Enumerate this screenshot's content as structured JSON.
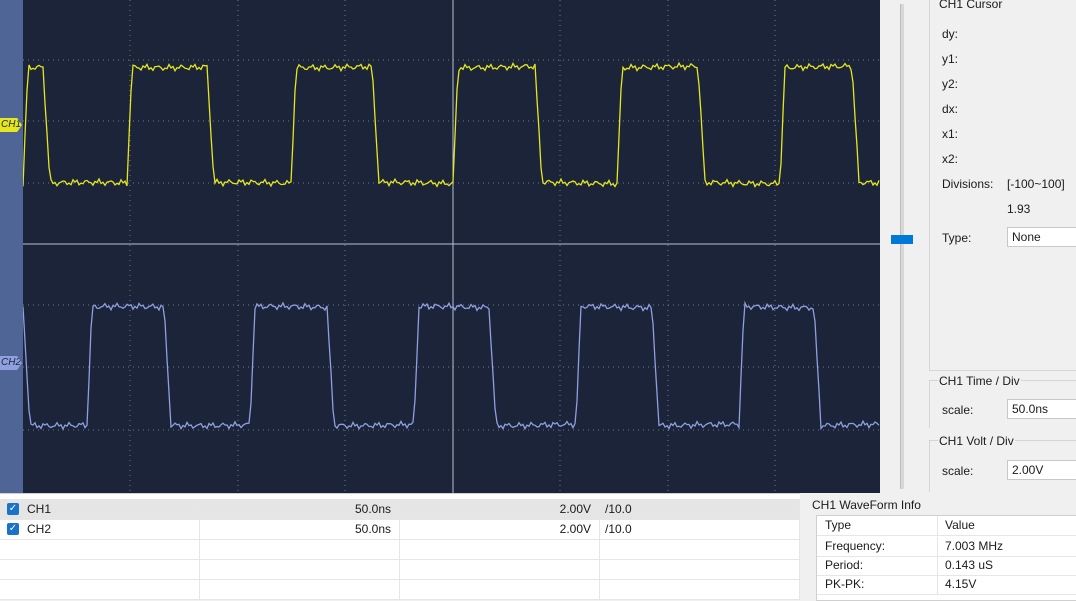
{
  "scope": {
    "ch1_marker": "CH1",
    "ch2_marker": "CH2",
    "ch1_color": "#e6e61e",
    "ch2_color": "#8f9fe0",
    "background": "#1b2438"
  },
  "cursor_panel": {
    "title": "CH1 Cursor",
    "dy_label": "dy:",
    "y1_label": "y1:",
    "y2_label": "y2:",
    "dx_label": "dx:",
    "x1_label": "x1:",
    "x2_label": "x2:",
    "divisions_label": "Divisions:",
    "divisions_range": "[-100~100]",
    "divisions_value": "1.93",
    "type_label": "Type:",
    "type_value": "None"
  },
  "time_panel": {
    "title": "CH1 Time / Div",
    "scale_label": "scale:",
    "scale_value": "50.0ns"
  },
  "volt_panel": {
    "title": "CH1 Volt / Div",
    "scale_label": "scale:",
    "scale_value": "2.00V"
  },
  "channels": [
    {
      "name": "CH1",
      "time": "50.0ns",
      "volt": "2.00V",
      "probe": "/10.0"
    },
    {
      "name": "CH2",
      "time": "50.0ns",
      "volt": "2.00V",
      "probe": "/10.0"
    }
  ],
  "waveform_info": {
    "title": "CH1 WaveForm Info",
    "header_type": "Type",
    "header_value": "Value",
    "rows": [
      {
        "k": "Frequency:",
        "v": "7.003 MHz"
      },
      {
        "k": "Period:",
        "v": "0.143 uS"
      },
      {
        "k": "PK-PK:",
        "v": "4.15V"
      }
    ]
  }
}
